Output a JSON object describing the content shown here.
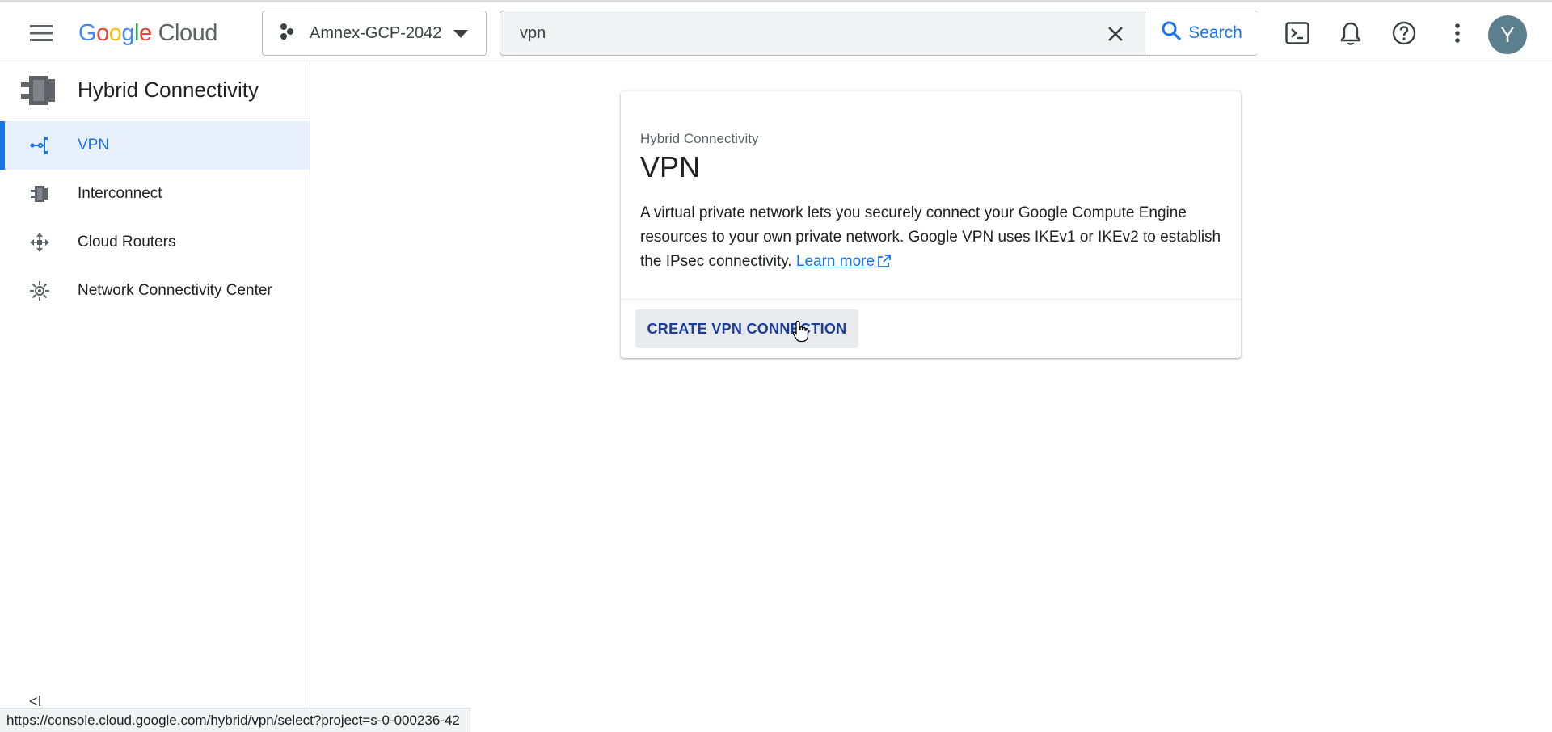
{
  "header": {
    "logo_letters": [
      "G",
      "o",
      "o",
      "g",
      "l",
      "e"
    ],
    "logo_suffix": "Cloud",
    "project_name": "Amnex-GCP-2042",
    "search_value": "vpn",
    "search_button": "Search",
    "avatar_letter": "Y",
    "icons": [
      "menu-icon",
      "project-icon",
      "chevron-down-icon",
      "close-icon",
      "search-icon",
      "terminal-icon",
      "bell-icon",
      "help-icon",
      "more-vert-icon"
    ]
  },
  "sidebar": {
    "title": "Hybrid Connectivity",
    "items": [
      {
        "label": "VPN",
        "icon": "vpn-icon",
        "active": true
      },
      {
        "label": "Interconnect",
        "icon": "interconnect-icon",
        "active": false
      },
      {
        "label": "Cloud Routers",
        "icon": "cloud-routers-icon",
        "active": false
      },
      {
        "label": "Network Connectivity Center",
        "icon": "ncc-icon",
        "active": false
      }
    ],
    "collapse_label": "<I"
  },
  "main": {
    "card": {
      "eyebrow": "Hybrid Connectivity",
      "title": "VPN",
      "description": "A virtual private network lets you securely connect your Google Compute Engine resources to your own private network. Google VPN uses IKEv1 or IKEv2 to establish the IPsec connectivity.",
      "learn_more": "Learn more",
      "cta": "CREATE VPN CONNECTION"
    }
  },
  "status_bar": {
    "url": "https://console.cloud.google.com/hybrid/vpn/select?project=s-0-000236-42"
  },
  "colors": {
    "accent": "#1a73e8",
    "active_bg": "#e8f0fe",
    "avatar_bg": "#5b7f8f"
  }
}
